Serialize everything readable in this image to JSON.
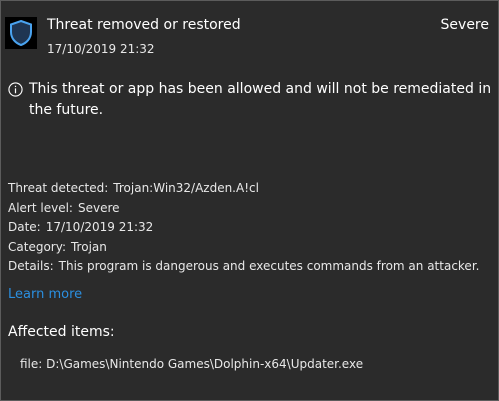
{
  "header": {
    "title": "Threat removed or restored",
    "severity": "Severe",
    "timestamp": "17/10/2019 21:32",
    "icon": "shield-icon"
  },
  "notice": {
    "icon": "info-icon",
    "text": "This threat or app has been allowed and will not be remediated in the future."
  },
  "details": [
    {
      "label": "Threat detected:",
      "value": "Trojan:Win32/Azden.A!cl"
    },
    {
      "label": "Alert level:",
      "value": "Severe"
    },
    {
      "label": "Date:",
      "value": "17/10/2019 21:32"
    },
    {
      "label": "Category:",
      "value": "Trojan"
    },
    {
      "label": "Details:",
      "value": "This program is dangerous and executes commands from an attacker."
    }
  ],
  "learn_more": "Learn more",
  "affected": {
    "title": "Affected items:",
    "items": [
      "file: D:\\Games\\Nintendo Games\\Dolphin-x64\\Updater.exe"
    ]
  },
  "colors": {
    "background": "#2b2b2b",
    "link": "#2b8fe0",
    "shield_accent": "#4aa3f0"
  }
}
